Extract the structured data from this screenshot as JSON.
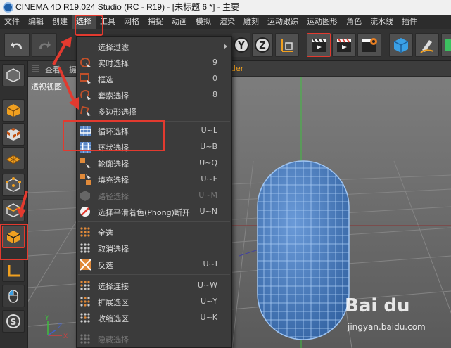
{
  "window": {
    "title": "CINEMA 4D R19.024 Studio (RC - R19) - [未标题 6 *] - 主要"
  },
  "menubar": [
    {
      "label": "文件"
    },
    {
      "label": "编辑"
    },
    {
      "label": "创建"
    },
    {
      "label": "选择"
    },
    {
      "label": "工具"
    },
    {
      "label": "网格"
    },
    {
      "label": "捕捉"
    },
    {
      "label": "动画"
    },
    {
      "label": "模拟"
    },
    {
      "label": "渲染"
    },
    {
      "label": "雕刻"
    },
    {
      "label": "运动跟踪"
    },
    {
      "label": "运动图形"
    },
    {
      "label": "角色"
    },
    {
      "label": "流水线"
    },
    {
      "label": "插件"
    }
  ],
  "viewport": {
    "header_left": "查看",
    "header_partial": "摄",
    "header_right": "der",
    "label": "透视视图",
    "axis_x": "X",
    "axis_y": "Y",
    "axis_z": "Z"
  },
  "toolbar": {
    "y_glyph": "Y",
    "z_glyph": "Z"
  },
  "dropdown": {
    "items": [
      {
        "label": "选择过滤",
        "shortcut": "",
        "icon": "submenu"
      },
      {
        "label": "实时选择",
        "shortcut": "9",
        "icon": "live-select-icon"
      },
      {
        "label": "框选",
        "shortcut": "0",
        "icon": "rectangle-select-icon"
      },
      {
        "label": "套索选择",
        "shortcut": "8",
        "icon": "lasso-select-icon"
      },
      {
        "label": "多边形选择",
        "shortcut": "",
        "icon": "polygon-select-icon"
      },
      {
        "label": "循环选择",
        "shortcut": "U~L",
        "icon": "loop-select-icon"
      },
      {
        "label": "环状选择",
        "shortcut": "U~B",
        "icon": "ring-select-icon"
      },
      {
        "label": "轮廓选择",
        "shortcut": "U~Q",
        "icon": "outline-select-icon"
      },
      {
        "label": "填充选择",
        "shortcut": "U~F",
        "icon": "fill-select-icon"
      },
      {
        "label": "路径选择",
        "shortcut": "U~M",
        "icon": "path-select-icon"
      },
      {
        "label": "选择平滑着色(Phong)断开",
        "shortcut": "U~N",
        "icon": "phong-break-icon"
      },
      {
        "label": "全选",
        "shortcut": "",
        "icon": "select-all-icon"
      },
      {
        "label": "取消选择",
        "shortcut": "",
        "icon": "deselect-icon"
      },
      {
        "label": "反选",
        "shortcut": "U~I",
        "icon": "invert-select-icon"
      },
      {
        "label": "选择连接",
        "shortcut": "U~W",
        "icon": "select-connected-icon"
      },
      {
        "label": "扩展选区",
        "shortcut": "U~Y",
        "icon": "grow-selection-icon"
      },
      {
        "label": "收缩选区",
        "shortcut": "U~K",
        "icon": "shrink-selection-icon"
      },
      {
        "label": "隐藏选择",
        "shortcut": "",
        "icon": "hide-selected-icon"
      }
    ]
  },
  "watermark": {
    "brand": "Bai du",
    "url": "jingyan.baidu.com"
  },
  "colors": {
    "accent": "#e23a2f",
    "menu_bg": "#3b3b3b",
    "mesh": "#4a7fc4",
    "mesh_line": "#8fb8ef"
  }
}
